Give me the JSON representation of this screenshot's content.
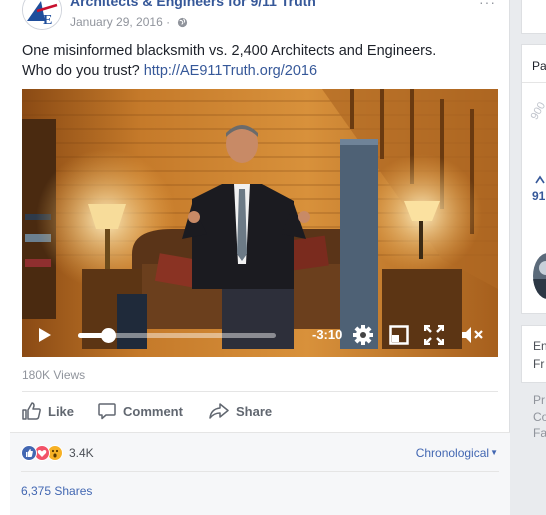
{
  "post": {
    "page_name": "Architects & Engineers for 9/11 Truth",
    "date": "January 29, 2016",
    "options": "···",
    "text_line1": "One misinformed blacksmith vs. 2,400 Architects and Engineers.",
    "text_line2_prefix": "Who do you trust? ",
    "link": "http://AE911Truth.org/2016"
  },
  "video": {
    "progress": 0.15,
    "time_remaining": "-3:10"
  },
  "stats": {
    "views": "180K Views",
    "reaction_count": "3.4K",
    "shares": "6,375 Shares"
  },
  "actions": {
    "like": "Like",
    "comment": "Comment",
    "share": "Share"
  },
  "comments": {
    "sort_label": "Chronological"
  },
  "sidebar": {
    "page_label": "Pa",
    "count_fragment": "91",
    "en_fragment": "En",
    "fr_fragment": "Fr",
    "pr_fragment": "Pr",
    "co_fragment": "Co",
    "fa_fragment": "Fa"
  },
  "colors": {
    "link": "#365899",
    "like_blue": "#4267b2",
    "love_red": "#f25268",
    "wow_yellow": "#f7b125"
  }
}
